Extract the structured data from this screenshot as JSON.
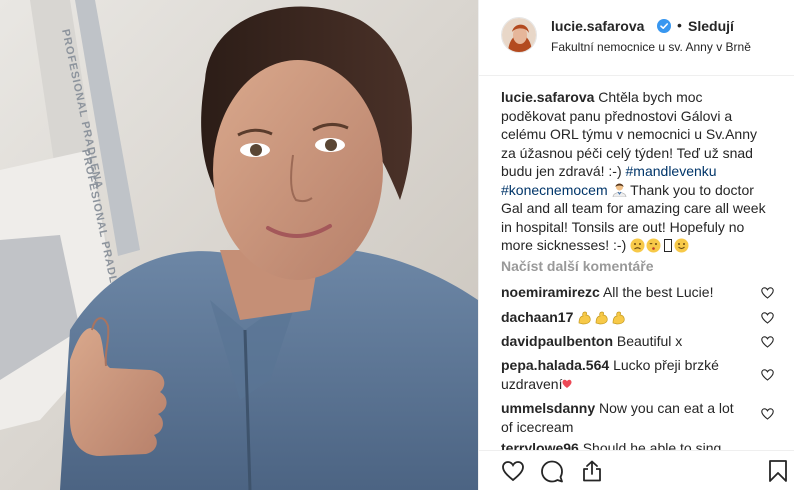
{
  "post": {
    "username": "lucie.safarova",
    "separator": "•",
    "follow_label": "Sledují",
    "location": "Fakultní nemocnice u sv. Anny v Brně"
  },
  "caption": {
    "username": "lucie.safarova",
    "text_cz": "Chtěla bych moc poděkovat panu přednostovi Gálovi a celému ORL týmu v nemocnici u Sv.Anny za úžasnou péči celý týden! Teď už snad budu jen zdravá! :-)",
    "hashtag_1": "#mandlevenku",
    "hashtag_2": "#konecnemocem",
    "text_en": "Thank you to doctor Gal and all team for amazing care all week in hospital! Tonsils are out! Hopefuly no more sicknesses! :-)"
  },
  "load_more_label": "Načíst další komentáře",
  "comments": [
    {
      "user": "noemiramirezc",
      "text": "All the best Lucie!"
    },
    {
      "user": "dachaan17",
      "text": ""
    },
    {
      "user": "davidpaulbenton",
      "text": "Beautiful x"
    },
    {
      "user": "pepa.halada.564",
      "text": "Lucko přeji brzké uzdravení"
    },
    {
      "user": "ummelsdanny",
      "text": "Now you can eat a lot of icecream"
    },
    {
      "user": "terrylowe96",
      "text": "Should he able to sing"
    }
  ],
  "photo_text": {
    "pillow_line_1": "PROFESIONAL PRADLENA",
    "pillow_line_2": "PROFESIONAL PRADLENA"
  },
  "colors": {
    "hashtag": "#003569",
    "verified": "#3897f0",
    "muted": "#999999",
    "heart": "#ed4956"
  },
  "icons": [
    "verified-badge-icon",
    "heart-icon",
    "comment-icon",
    "share-icon",
    "bookmark-icon",
    "flexed-biceps-icon",
    "woman-health-worker-icon"
  ]
}
